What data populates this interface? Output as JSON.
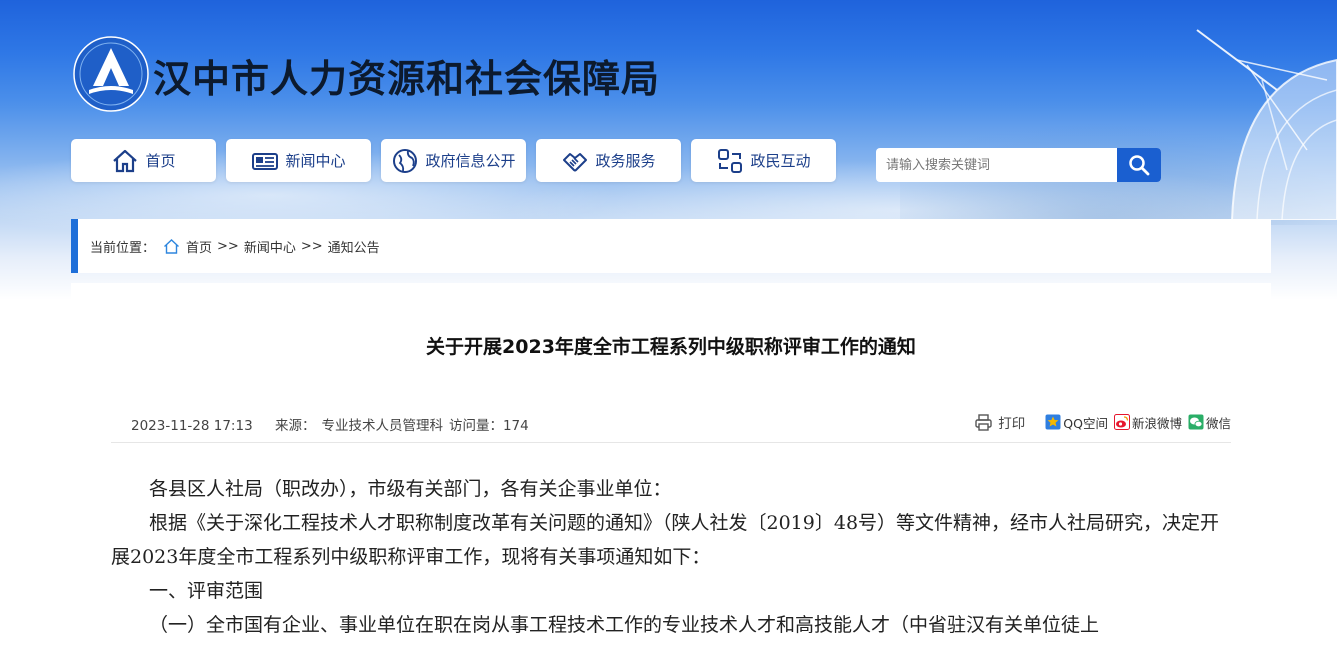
{
  "site": {
    "title": "汉中市人力资源和社会保障局",
    "logo_icon": "hrss-logo-icon"
  },
  "nav": {
    "items": [
      {
        "label": "首页",
        "icon": "home-icon"
      },
      {
        "label": "新闻中心",
        "icon": "newspaper-icon"
      },
      {
        "label": "政府信息公开",
        "icon": "globe-icon"
      },
      {
        "label": "政务服务",
        "icon": "handshake-icon"
      },
      {
        "label": "政民互动",
        "icon": "interaction-icon"
      }
    ]
  },
  "search": {
    "placeholder": "请输入搜索关键词",
    "button_icon": "search-icon"
  },
  "breadcrumb": {
    "label": "当前位置：",
    "items": [
      "首页",
      "新闻中心",
      "通知公告"
    ],
    "separator": ">>"
  },
  "article": {
    "title": "关于开展2023年度全市工程系列中级职称评审工作的通知",
    "date": "2023-11-28 17:13",
    "source_label": "来源：",
    "source": "专业技术人员管理科",
    "views_label": "访问量：",
    "views": "174",
    "print_label": "打印",
    "share": [
      {
        "label": "QQ空间",
        "icon": "qzone-icon",
        "color": "#f5b800"
      },
      {
        "label": "新浪微博",
        "icon": "weibo-icon",
        "color": "#e6162d"
      },
      {
        "label": "微信",
        "icon": "wechat-icon",
        "color": "#2aae67"
      }
    ],
    "paragraphs": [
      "各县区人社局（职改办），市级有关部门，各有关企事业单位：",
      "根据《关于深化工程技术人才职称制度改革有关问题的通知》（陕人社发〔2019〕48号）等文件精神，经市人社局研究，决定开展2023年度全市工程系列中级职称评审工作，现将有关事项通知如下：",
      "一、评审范围",
      "（一）全市国有企业、事业单位在职在岗从事工程技术工作的专业技术人才和高技能人才（中省驻汉有关单位徒上"
    ]
  },
  "colors": {
    "accent": "#1e6fd9",
    "nav_text": "#1c3f8a",
    "search_button": "#1a5fd0"
  }
}
